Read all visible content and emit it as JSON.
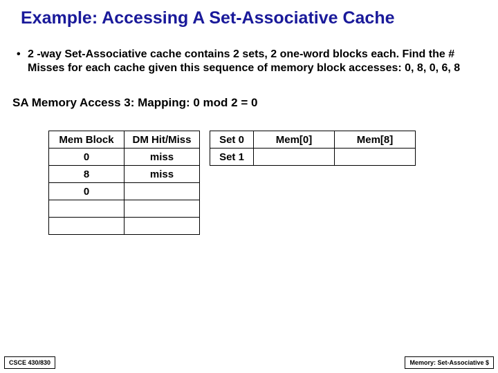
{
  "title": "Example: Accessing A Set-Associative Cache",
  "bullet": "2 -way Set-Associative cache contains 2 sets, 2 one-word blocks each. Find the # Misses for each cache given this sequence of memory block accesses: 0, 8, 0, 6, 8",
  "subhead": "SA Memory Access 3:  Mapping: 0 mod 2 = 0",
  "t1": {
    "h1": "Mem Block",
    "h2": "DM Hit/Miss",
    "r1c1": "0",
    "r1c2": "miss",
    "r2c1": "8",
    "r2c2": "miss",
    "r3c1": "0",
    "r3c2": "",
    "r4c1": "",
    "r4c2": "",
    "r5c1": "",
    "r5c2": ""
  },
  "t2": {
    "row0lbl": "Set 0",
    "row0c1": "Mem[0]",
    "row0c2": "Mem[8]",
    "row1lbl": "Set 1",
    "row1c1": "",
    "row1c2": ""
  },
  "footer": {
    "left": "CSCE 430/830",
    "right": "Memory: Set-Associative $"
  }
}
